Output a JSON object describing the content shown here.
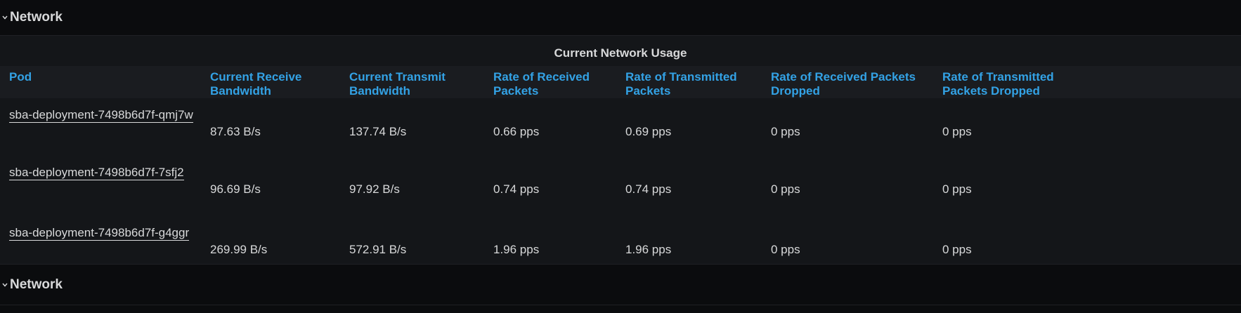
{
  "rows": [
    {
      "title": "Network"
    },
    {
      "title": "Network"
    }
  ],
  "panel": {
    "title": "Current Network Usage",
    "columns": [
      "Pod",
      "Current Receive Bandwidth",
      "Current Transmit Bandwidth",
      "Rate of Received Packets",
      "Rate of Transmitted Packets",
      "Rate of Received Packets Dropped",
      "Rate of Transmitted Packets Dropped"
    ],
    "data": [
      [
        "sba-deployment-7498b6d7f-qmj7w",
        "87.63 B/s",
        "137.74 B/s",
        "0.66 pps",
        "0.69 pps",
        "0 pps",
        "0 pps"
      ],
      [
        "sba-deployment-7498b6d7f-7sfj2",
        "96.69 B/s",
        "97.92 B/s",
        "0.74 pps",
        "0.74 pps",
        "0 pps",
        "0 pps"
      ],
      [
        "sba-deployment-7498b6d7f-g4ggr",
        "269.99 B/s",
        "572.91 B/s",
        "1.96 pps",
        "1.96 pps",
        "0 pps",
        "0 pps"
      ]
    ]
  },
  "colors": {
    "header_text": "#33a2e5",
    "background": "#0b0c0e",
    "panel_bg": "#141619"
  },
  "icons": {
    "row_toggle": "chevron-down-icon"
  }
}
